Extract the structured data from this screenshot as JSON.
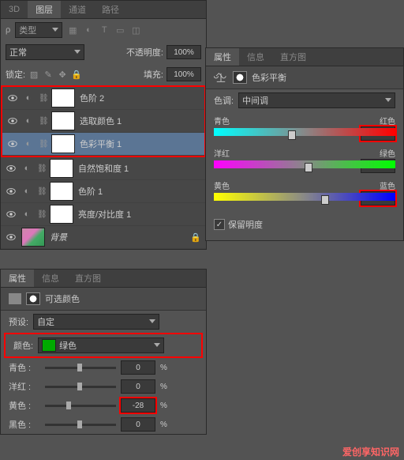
{
  "layers_panel": {
    "tabs": [
      "3D",
      "图层",
      "通道",
      "路径"
    ],
    "active_tab": "图层",
    "filter_label": "类型",
    "blend_mode": "正常",
    "opacity_label": "不透明度:",
    "opacity_value": "100%",
    "lock_label": "锁定:",
    "fill_label": "填充:",
    "fill_value": "100%",
    "layers": [
      {
        "name": "色阶 2",
        "sel": false
      },
      {
        "name": "选取颜色 1",
        "sel": false
      },
      {
        "name": "色彩平衡 1",
        "sel": true
      },
      {
        "name": "自然饱和度 1",
        "sel": false
      },
      {
        "name": "色阶 1",
        "sel": false
      },
      {
        "name": "亮度/对比度 1",
        "sel": false
      }
    ],
    "bg_layer": "背景"
  },
  "color_balance": {
    "tabs": [
      "属性",
      "信息",
      "直方图"
    ],
    "title": "色彩平衡",
    "tone_label": "色调:",
    "tone_value": "中间调",
    "sliders": [
      {
        "left": "青色",
        "right": "红色",
        "value": "-17",
        "thumb_pct": 41,
        "hi": true
      },
      {
        "left": "洋红",
        "right": "绿色",
        "value": "0",
        "thumb_pct": 50,
        "hi": false
      },
      {
        "left": "黄色",
        "right": "蓝色",
        "value": "+17",
        "thumb_pct": 59,
        "hi": true
      }
    ],
    "preserve": "保留明度"
  },
  "selective_color": {
    "tabs": [
      "属性",
      "信息",
      "直方图"
    ],
    "title": "可选颜色",
    "preset_label": "预设:",
    "preset_value": "自定",
    "color_label": "颜色:",
    "color_value": "绿色",
    "channels": [
      {
        "name": "青色 :",
        "value": "0"
      },
      {
        "name": "洋红 :",
        "value": "0"
      },
      {
        "name": "黄色 :",
        "value": "-28",
        "hi": true
      },
      {
        "name": "黑色 :",
        "value": "0"
      }
    ],
    "pct": "%"
  },
  "watermark": "爱创享知识网"
}
